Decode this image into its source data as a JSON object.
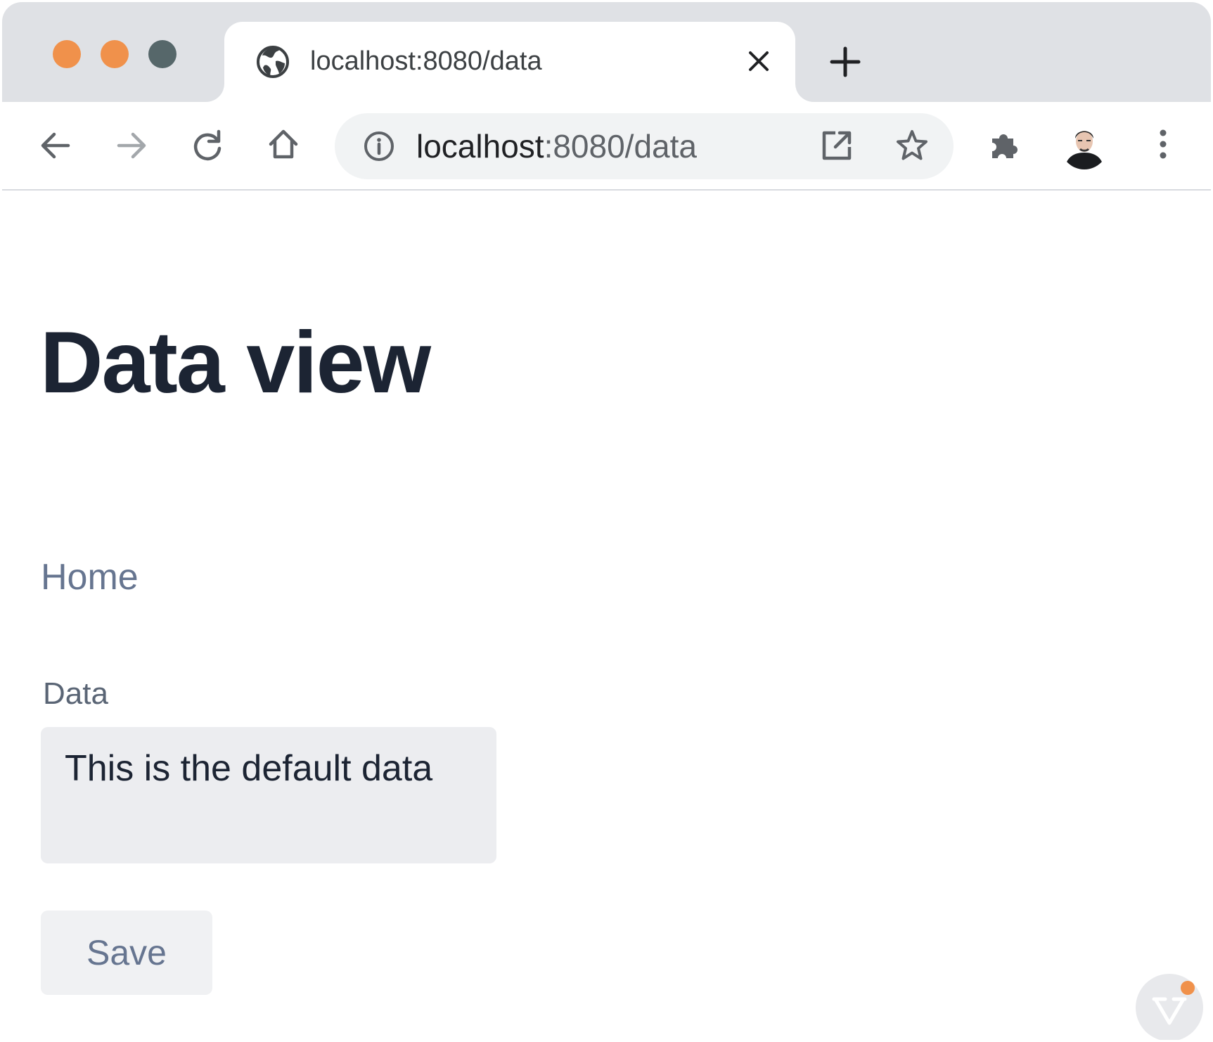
{
  "tab": {
    "title": "localhost:8080/data"
  },
  "address": {
    "host": "localhost",
    "rest": ":8080/data"
  },
  "page": {
    "title": "Data view",
    "home_link": "Home",
    "data_label": "Data",
    "data_value": "This is the default data",
    "save_label": "Save"
  },
  "colors": {
    "accent": "#f0914b",
    "traffic_max": "#56676a",
    "heading": "#1c2433",
    "muted": "#667590"
  },
  "icons": [
    "globe-icon",
    "close-icon",
    "plus-icon",
    "back-arrow-icon",
    "forward-arrow-icon",
    "reload-icon",
    "home-icon",
    "info-icon",
    "open-in-new-icon",
    "star-icon",
    "puzzle-icon",
    "avatar",
    "kebab-menu-icon",
    "dev-tools-icon"
  ]
}
